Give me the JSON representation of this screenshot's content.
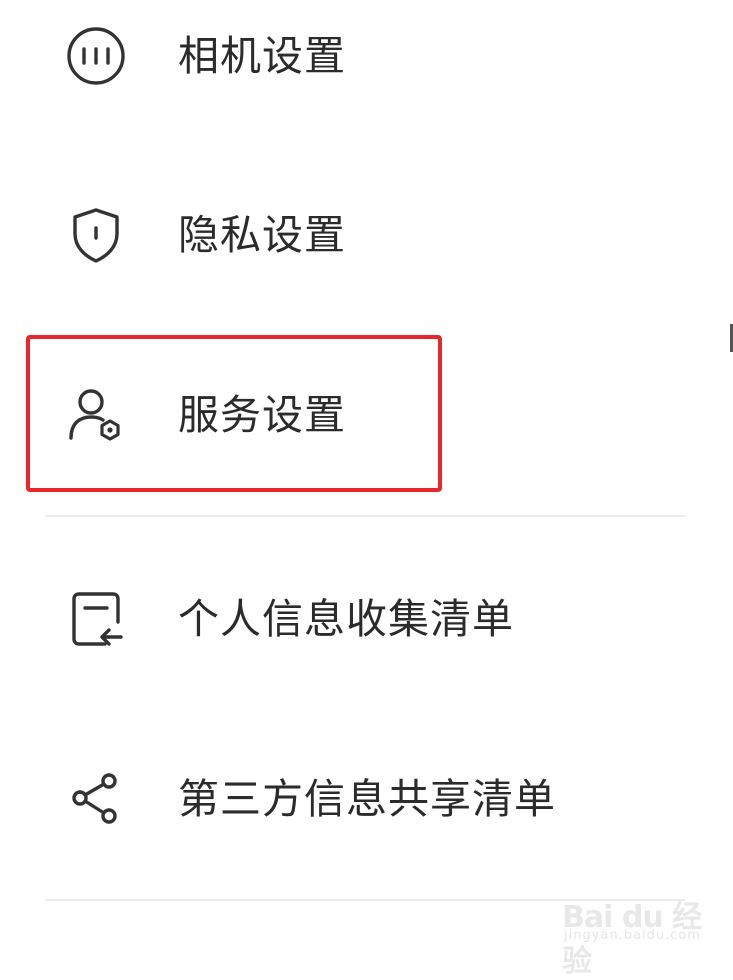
{
  "menu": {
    "items": [
      {
        "label": "相机设置",
        "icon": "camera-settings-icon"
      },
      {
        "label": "隐私设置",
        "icon": "shield-icon"
      },
      {
        "label": "服务设置",
        "icon": "user-service-icon"
      },
      {
        "label": "个人信息收集清单",
        "icon": "document-return-icon"
      },
      {
        "label": "第三方信息共享清单",
        "icon": "share-icon"
      }
    ]
  },
  "highlight": {
    "target": "服务设置",
    "color": "#e8262b"
  },
  "watermark": {
    "logo": "Bai du 经验",
    "url": "jingyan.baidu.com"
  }
}
